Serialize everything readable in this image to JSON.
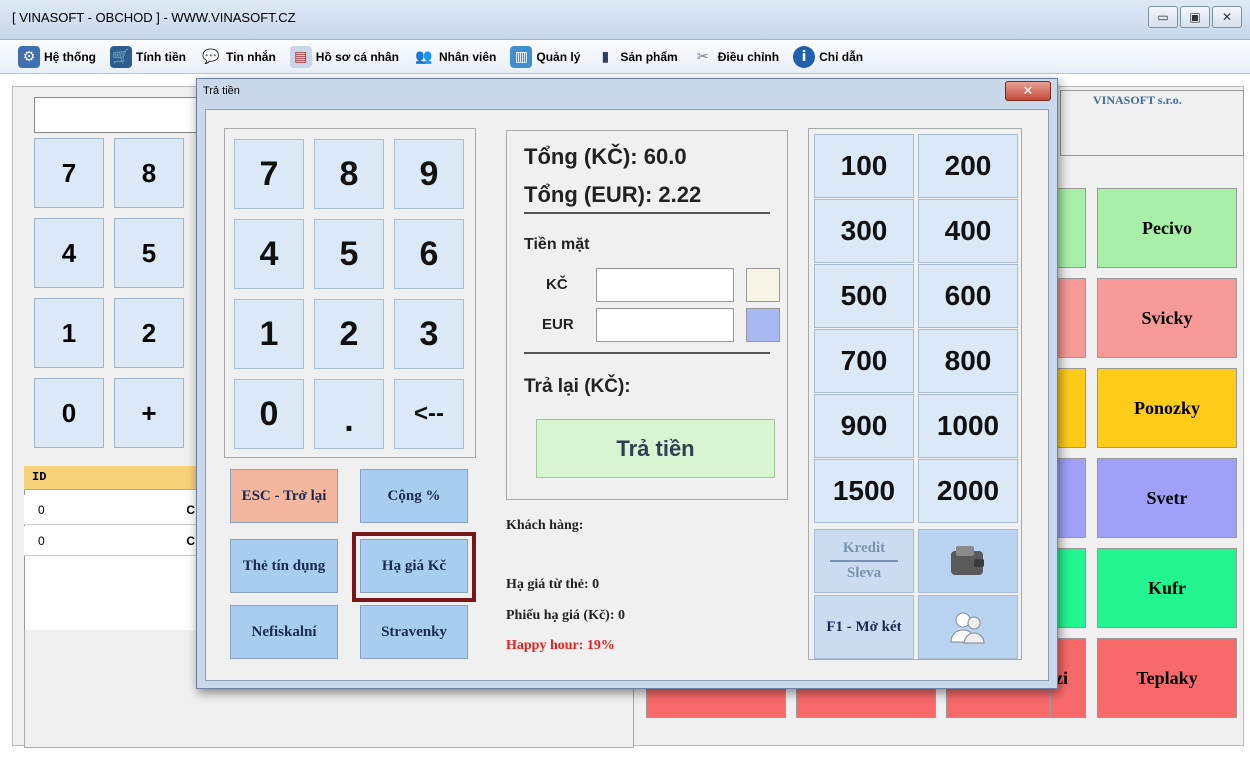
{
  "window": {
    "title": "[ VINASOFT - OBCHOD ] - WWW.VINASOFT.CZ",
    "min": "▭",
    "max": "▣",
    "close": "✕"
  },
  "menu": [
    {
      "label": "Hệ thống",
      "icon": "system-icon",
      "glyph": "⚙"
    },
    {
      "label": "Tính tiền",
      "icon": "basket-icon",
      "glyph": "🛒"
    },
    {
      "label": "Tin nhắn",
      "icon": "message-icon",
      "glyph": "💬"
    },
    {
      "label": "Hồ sơ cá nhân",
      "icon": "profile-icon",
      "glyph": "▤"
    },
    {
      "label": "Nhân viên",
      "icon": "users-icon",
      "glyph": "👥"
    },
    {
      "label": "Quản lý",
      "icon": "books-icon",
      "glyph": "▥"
    },
    {
      "label": "Sản phẩm",
      "icon": "barcode-icon",
      "glyph": "▮"
    },
    {
      "label": "Điều chỉnh",
      "icon": "tools-icon",
      "glyph": "✂"
    },
    {
      "label": "Chỉ dẫn",
      "icon": "info-icon",
      "glyph": "i"
    }
  ],
  "background": {
    "company": "VINASOFT s.r.o.",
    "keys": [
      "7",
      "8",
      "4",
      "5",
      "1",
      "2",
      "0",
      "+"
    ],
    "table": {
      "header": "ID",
      "rows": [
        {
          "id": "0",
          "val": "C"
        },
        {
          "id": "0",
          "val": "C"
        }
      ]
    },
    "categories": [
      "Pecivo",
      "Svicky",
      "Ponozky",
      "Svetr",
      "Kufr",
      "Teplaky"
    ],
    "partial": "zi"
  },
  "dialog": {
    "title": "Trả tiền",
    "close": "✕",
    "keypad": [
      "7",
      "8",
      "9",
      "4",
      "5",
      "6",
      "1",
      "2",
      "3",
      "0",
      ".",
      "<--"
    ],
    "buttons": {
      "esc": "ESC - Trở lại",
      "add_percent": "Cộng %",
      "credit_card": "Thẻ tín dụng",
      "discount_czk": "Hạ giá Kč",
      "nonfiscal": "Nefiskalní",
      "meal_vouchers": "Stravenky"
    },
    "total_czk": "Tổng (KČ): 60.0",
    "total_eur": "Tổng (EUR): 2.22",
    "cash_label": "Tiền mặt",
    "czk_label": "KČ",
    "eur_label": "EUR",
    "czk_value": "",
    "eur_value": "",
    "change_label": "Trả lại (KČ):",
    "pay_button": "Trả tiền",
    "customer_label": "Khách hàng:",
    "card_discount": "Hạ giá từ thẻ: 0",
    "voucher_discount": "Phiếu hạ giá (Kč): 0",
    "happy_hour": "Happy hour: 19%",
    "amounts": [
      "100",
      "200",
      "300",
      "400",
      "500",
      "600",
      "700",
      "800",
      "900",
      "1000",
      "1500",
      "2000"
    ],
    "kredit": "Kredit",
    "sleva": "Sleva",
    "open_drawer": "F1 - Mở két"
  },
  "colors": {
    "happy_hour": "#e8201c",
    "selected_border": "#7a1518"
  }
}
